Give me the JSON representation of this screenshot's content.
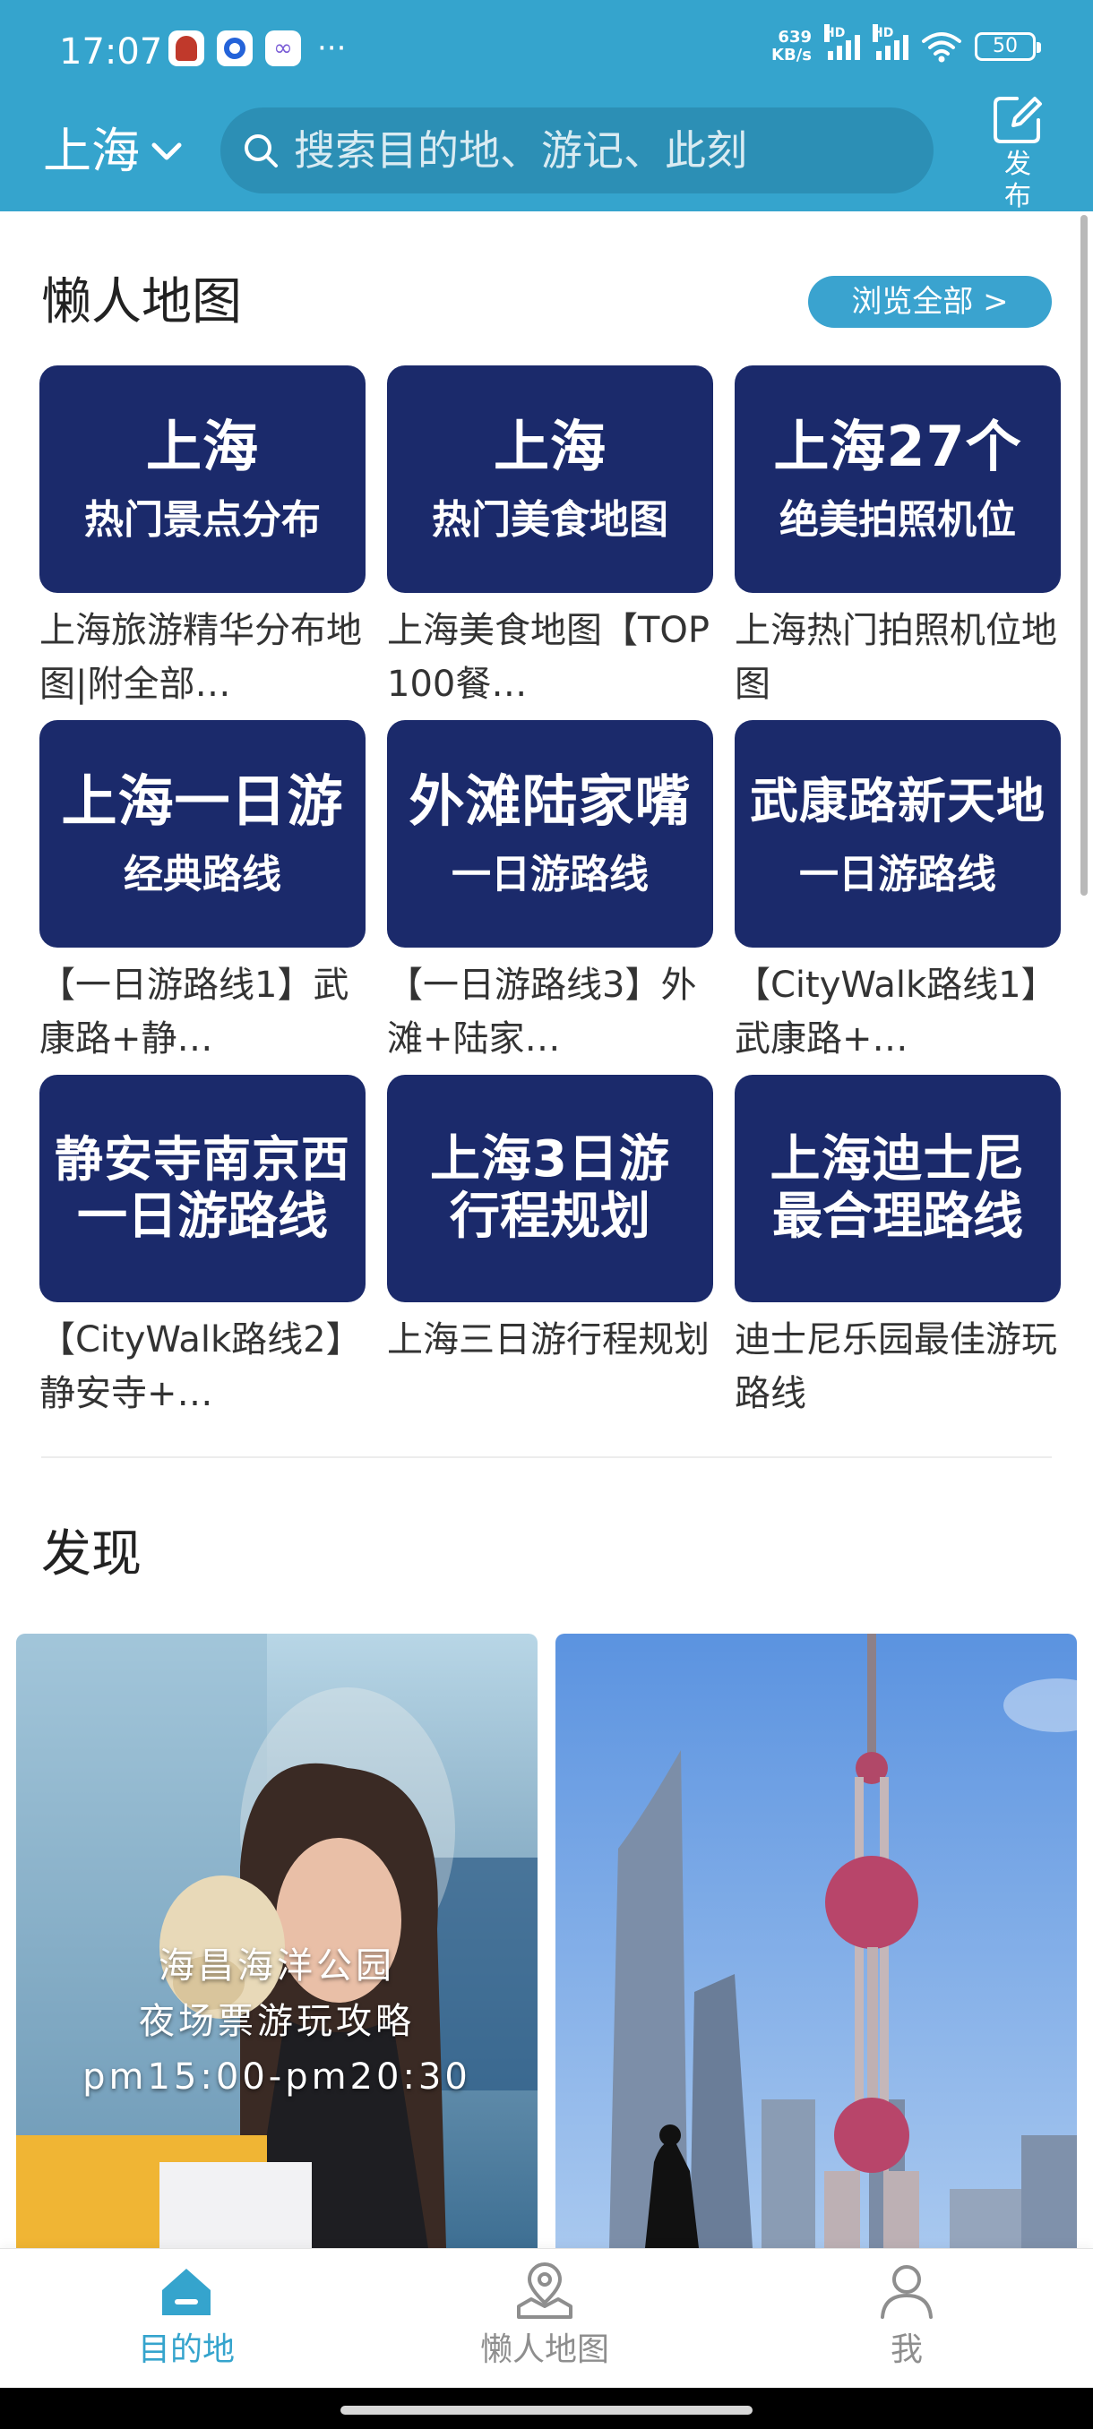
{
  "status_bar": {
    "time": "17:07",
    "net_speed_value": "639",
    "net_speed_unit": "KB/s",
    "hd": "HD",
    "battery": "50",
    "more": "···"
  },
  "header": {
    "city": "上海",
    "search_placeholder": "搜索目的地、游记、此刻",
    "publish_label": "发布"
  },
  "lazy_maps": {
    "title": "懒人地图",
    "browse_all": "浏览全部 >",
    "items": [
      {
        "cover_line1": "上海",
        "cover_line2": "热门景点分布",
        "caption": "上海旅游精华分布地图|附全部…"
      },
      {
        "cover_line1": "上海",
        "cover_line2": "热门美食地图",
        "caption": "上海美食地图【TOP100餐…"
      },
      {
        "cover_line1": "上海27个",
        "cover_line2": "绝美拍照机位",
        "caption": "上海热门拍照机位地图"
      },
      {
        "cover_line1": "上海一日游",
        "cover_line2": "经典路线",
        "caption": "【一日游路线1】武康路+静…"
      },
      {
        "cover_line1": "外滩陆家嘴",
        "cover_line2": "一日游路线",
        "caption": "【一日游路线3】外滩+陆家…"
      },
      {
        "cover_line1": "武康路新天地",
        "cover_line2": "一日游路线",
        "caption": "【CityWalk路线1】武康路+…"
      },
      {
        "cover_line1": "静安寺南京西",
        "cover_line2": "一日游路线",
        "caption": "【CityWalk路线2】静安寺+…"
      },
      {
        "cover_line1": "上海3日游",
        "cover_line2": "行程规划",
        "caption": "上海三日游行程规划"
      },
      {
        "cover_line1": "上海迪士尼",
        "cover_line2": "最合理路线",
        "caption": "迪士尼乐园最佳游玩路线"
      }
    ]
  },
  "discover": {
    "title": "发现",
    "cards": [
      {
        "overlay_line1": "海昌海洋公园",
        "overlay_line2": "夜场票游玩攻略",
        "overlay_line3": "pm15:00-pm20:30"
      }
    ]
  },
  "bottom_nav": {
    "items": [
      {
        "label": "目的地",
        "active": true
      },
      {
        "label": "懒人地图",
        "active": false
      },
      {
        "label": "我",
        "active": false
      }
    ]
  },
  "colors": {
    "header_bg": "#35a4cd",
    "cover_bg": "#1b2a6b",
    "accent": "#35a4cd",
    "nav_inactive": "#8e8e8e"
  }
}
